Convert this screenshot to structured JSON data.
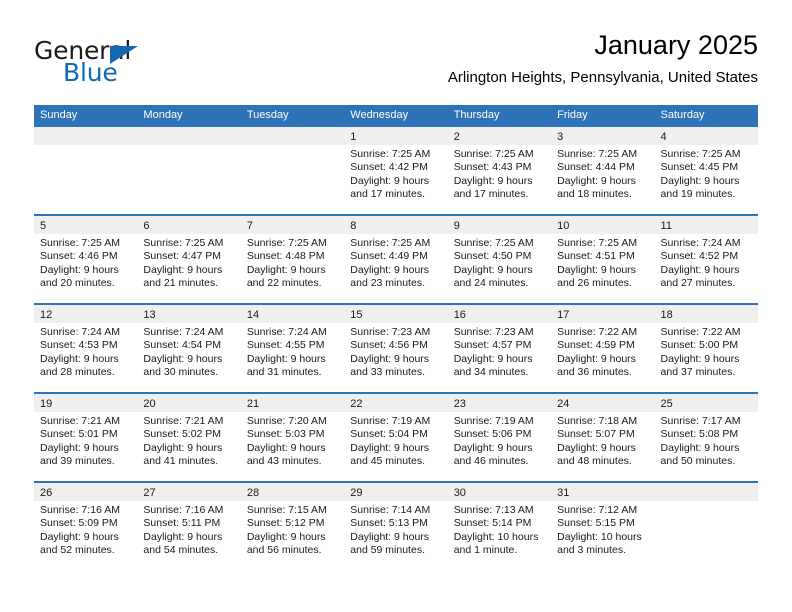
{
  "brand": {
    "line1": "General",
    "line2": "Blue",
    "accent_color": "#1368b4",
    "triangle_icon": "triangle-icon"
  },
  "header": {
    "title": "January 2025",
    "location": "Arlington Heights, Pennsylvania, United States"
  },
  "theme": {
    "header_blue": "#2e72b8",
    "daynum_band": "#efefef",
    "text": "#1a1a1a",
    "page_background": "#ffffff"
  },
  "weekdays": [
    "Sunday",
    "Monday",
    "Tuesday",
    "Wednesday",
    "Thursday",
    "Friday",
    "Saturday"
  ],
  "weeks": [
    [
      {
        "empty": true
      },
      {
        "empty": true
      },
      {
        "empty": true
      },
      {
        "day": "1",
        "sunrise": "Sunrise: 7:25 AM",
        "sunset": "Sunset: 4:42 PM",
        "daylight1": "Daylight: 9 hours",
        "daylight2": "and 17 minutes."
      },
      {
        "day": "2",
        "sunrise": "Sunrise: 7:25 AM",
        "sunset": "Sunset: 4:43 PM",
        "daylight1": "Daylight: 9 hours",
        "daylight2": "and 17 minutes."
      },
      {
        "day": "3",
        "sunrise": "Sunrise: 7:25 AM",
        "sunset": "Sunset: 4:44 PM",
        "daylight1": "Daylight: 9 hours",
        "daylight2": "and 18 minutes."
      },
      {
        "day": "4",
        "sunrise": "Sunrise: 7:25 AM",
        "sunset": "Sunset: 4:45 PM",
        "daylight1": "Daylight: 9 hours",
        "daylight2": "and 19 minutes."
      }
    ],
    [
      {
        "day": "5",
        "sunrise": "Sunrise: 7:25 AM",
        "sunset": "Sunset: 4:46 PM",
        "daylight1": "Daylight: 9 hours",
        "daylight2": "and 20 minutes."
      },
      {
        "day": "6",
        "sunrise": "Sunrise: 7:25 AM",
        "sunset": "Sunset: 4:47 PM",
        "daylight1": "Daylight: 9 hours",
        "daylight2": "and 21 minutes."
      },
      {
        "day": "7",
        "sunrise": "Sunrise: 7:25 AM",
        "sunset": "Sunset: 4:48 PM",
        "daylight1": "Daylight: 9 hours",
        "daylight2": "and 22 minutes."
      },
      {
        "day": "8",
        "sunrise": "Sunrise: 7:25 AM",
        "sunset": "Sunset: 4:49 PM",
        "daylight1": "Daylight: 9 hours",
        "daylight2": "and 23 minutes."
      },
      {
        "day": "9",
        "sunrise": "Sunrise: 7:25 AM",
        "sunset": "Sunset: 4:50 PM",
        "daylight1": "Daylight: 9 hours",
        "daylight2": "and 24 minutes."
      },
      {
        "day": "10",
        "sunrise": "Sunrise: 7:25 AM",
        "sunset": "Sunset: 4:51 PM",
        "daylight1": "Daylight: 9 hours",
        "daylight2": "and 26 minutes."
      },
      {
        "day": "11",
        "sunrise": "Sunrise: 7:24 AM",
        "sunset": "Sunset: 4:52 PM",
        "daylight1": "Daylight: 9 hours",
        "daylight2": "and 27 minutes."
      }
    ],
    [
      {
        "day": "12",
        "sunrise": "Sunrise: 7:24 AM",
        "sunset": "Sunset: 4:53 PM",
        "daylight1": "Daylight: 9 hours",
        "daylight2": "and 28 minutes."
      },
      {
        "day": "13",
        "sunrise": "Sunrise: 7:24 AM",
        "sunset": "Sunset: 4:54 PM",
        "daylight1": "Daylight: 9 hours",
        "daylight2": "and 30 minutes."
      },
      {
        "day": "14",
        "sunrise": "Sunrise: 7:24 AM",
        "sunset": "Sunset: 4:55 PM",
        "daylight1": "Daylight: 9 hours",
        "daylight2": "and 31 minutes."
      },
      {
        "day": "15",
        "sunrise": "Sunrise: 7:23 AM",
        "sunset": "Sunset: 4:56 PM",
        "daylight1": "Daylight: 9 hours",
        "daylight2": "and 33 minutes."
      },
      {
        "day": "16",
        "sunrise": "Sunrise: 7:23 AM",
        "sunset": "Sunset: 4:57 PM",
        "daylight1": "Daylight: 9 hours",
        "daylight2": "and 34 minutes."
      },
      {
        "day": "17",
        "sunrise": "Sunrise: 7:22 AM",
        "sunset": "Sunset: 4:59 PM",
        "daylight1": "Daylight: 9 hours",
        "daylight2": "and 36 minutes."
      },
      {
        "day": "18",
        "sunrise": "Sunrise: 7:22 AM",
        "sunset": "Sunset: 5:00 PM",
        "daylight1": "Daylight: 9 hours",
        "daylight2": "and 37 minutes."
      }
    ],
    [
      {
        "day": "19",
        "sunrise": "Sunrise: 7:21 AM",
        "sunset": "Sunset: 5:01 PM",
        "daylight1": "Daylight: 9 hours",
        "daylight2": "and 39 minutes."
      },
      {
        "day": "20",
        "sunrise": "Sunrise: 7:21 AM",
        "sunset": "Sunset: 5:02 PM",
        "daylight1": "Daylight: 9 hours",
        "daylight2": "and 41 minutes."
      },
      {
        "day": "21",
        "sunrise": "Sunrise: 7:20 AM",
        "sunset": "Sunset: 5:03 PM",
        "daylight1": "Daylight: 9 hours",
        "daylight2": "and 43 minutes."
      },
      {
        "day": "22",
        "sunrise": "Sunrise: 7:19 AM",
        "sunset": "Sunset: 5:04 PM",
        "daylight1": "Daylight: 9 hours",
        "daylight2": "and 45 minutes."
      },
      {
        "day": "23",
        "sunrise": "Sunrise: 7:19 AM",
        "sunset": "Sunset: 5:06 PM",
        "daylight1": "Daylight: 9 hours",
        "daylight2": "and 46 minutes."
      },
      {
        "day": "24",
        "sunrise": "Sunrise: 7:18 AM",
        "sunset": "Sunset: 5:07 PM",
        "daylight1": "Daylight: 9 hours",
        "daylight2": "and 48 minutes."
      },
      {
        "day": "25",
        "sunrise": "Sunrise: 7:17 AM",
        "sunset": "Sunset: 5:08 PM",
        "daylight1": "Daylight: 9 hours",
        "daylight2": "and 50 minutes."
      }
    ],
    [
      {
        "day": "26",
        "sunrise": "Sunrise: 7:16 AM",
        "sunset": "Sunset: 5:09 PM",
        "daylight1": "Daylight: 9 hours",
        "daylight2": "and 52 minutes."
      },
      {
        "day": "27",
        "sunrise": "Sunrise: 7:16 AM",
        "sunset": "Sunset: 5:11 PM",
        "daylight1": "Daylight: 9 hours",
        "daylight2": "and 54 minutes."
      },
      {
        "day": "28",
        "sunrise": "Sunrise: 7:15 AM",
        "sunset": "Sunset: 5:12 PM",
        "daylight1": "Daylight: 9 hours",
        "daylight2": "and 56 minutes."
      },
      {
        "day": "29",
        "sunrise": "Sunrise: 7:14 AM",
        "sunset": "Sunset: 5:13 PM",
        "daylight1": "Daylight: 9 hours",
        "daylight2": "and 59 minutes."
      },
      {
        "day": "30",
        "sunrise": "Sunrise: 7:13 AM",
        "sunset": "Sunset: 5:14 PM",
        "daylight1": "Daylight: 10 hours",
        "daylight2": "and 1 minute."
      },
      {
        "day": "31",
        "sunrise": "Sunrise: 7:12 AM",
        "sunset": "Sunset: 5:15 PM",
        "daylight1": "Daylight: 10 hours",
        "daylight2": "and 3 minutes."
      },
      {
        "empty": true
      }
    ]
  ]
}
